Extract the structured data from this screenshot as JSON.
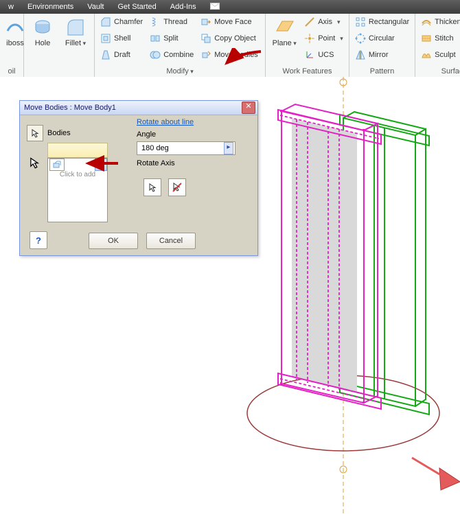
{
  "menus": [
    "w",
    "Environments",
    "Vault",
    "Get Started",
    "Add-Ins"
  ],
  "ribbon": {
    "panel1": {
      "left_big": "iboss",
      "hole": "Hole",
      "fillet": "Fillet"
    },
    "modify": {
      "chamfer": "Chamfer",
      "shell": "Shell",
      "draft": "Draft",
      "thread": "Thread",
      "split": "Split",
      "combine": "Combine",
      "moveface": "Move Face",
      "copyobj": "Copy Object",
      "movebodies": "Move Bodies",
      "footer": "Modify"
    },
    "workfeat": {
      "plane": "Plane",
      "axis": "Axis",
      "point": "Point",
      "ucs": "UCS",
      "footer": "Work Features"
    },
    "pattern": {
      "rect": "Rectangular",
      "circ": "Circular",
      "mirror": "Mirror",
      "footer": "Pattern"
    },
    "surface": {
      "thicken": "Thicken/Offset",
      "stitch": "Stitch",
      "sculpt": "Sculpt",
      "footer": "Surfac"
    }
  },
  "dialog": {
    "title": "Move Bodies : Move Body1",
    "link": "Rotate about line",
    "bodies_label": "Bodies",
    "angle_label": "Angle",
    "angle_value": "180 deg",
    "rotate_axis": "Rotate Axis",
    "list_hint": "Click to add",
    "ok": "OK",
    "cancel": "Cancel",
    "help": "?"
  }
}
